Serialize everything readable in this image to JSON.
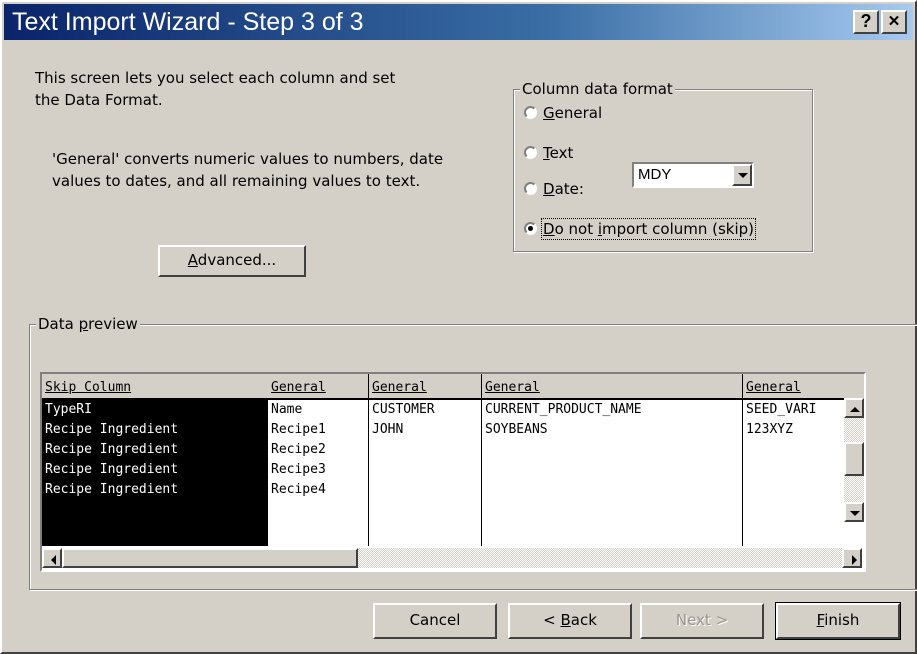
{
  "window": {
    "title": "Text Import Wizard - Step 3 of 3",
    "help_glyph": "?",
    "close_glyph": "✕"
  },
  "intro": {
    "line1": "This screen lets you select each column and set",
    "line2": "the Data Format.",
    "info1": "'General' converts numeric values to numbers, date",
    "info2": "values to dates, and all remaining values to text."
  },
  "advanced_button": {
    "pre": "",
    "accel": "A",
    "post": "dvanced..."
  },
  "column_format": {
    "legend": "Column data format",
    "options": [
      {
        "pre": "",
        "accel": "G",
        "post": "eneral",
        "checked": false
      },
      {
        "pre": "",
        "accel": "T",
        "post": "ext",
        "checked": false
      },
      {
        "pre": "",
        "accel": "D",
        "post": "ate:",
        "checked": false
      },
      {
        "pre": "",
        "accel": "D",
        "post": "o not ",
        "accel2": "i",
        "post2": "mport column (skip)",
        "checked": true
      }
    ],
    "date_format": "MDY"
  },
  "preview": {
    "legend_pre": "Data ",
    "legend_accel": "p",
    "legend_post": "review",
    "columns": [
      {
        "header": "Skip Column",
        "cells": [
          "TypeRI",
          "Recipe Ingredient",
          "Recipe Ingredient",
          "Recipe Ingredient",
          "Recipe Ingredient"
        ]
      },
      {
        "header": "General",
        "cells": [
          "Name",
          "Recipe1",
          "Recipe2",
          "Recipe3",
          "Recipe4"
        ]
      },
      {
        "header": "General",
        "cells": [
          "CUSTOMER",
          "JOHN",
          "",
          "",
          ""
        ]
      },
      {
        "header": "General",
        "cells": [
          "CURRENT_PRODUCT_NAME",
          "SOYBEANS",
          "",
          "",
          ""
        ]
      },
      {
        "header": "General",
        "cells": [
          "SEED_VARI",
          "123XYZ",
          "",
          "",
          ""
        ]
      }
    ]
  },
  "buttons": {
    "cancel": "Cancel",
    "back": {
      "pre": "< ",
      "accel": "B",
      "post": "ack"
    },
    "next": "Next >",
    "finish": {
      "pre": "",
      "accel": "F",
      "post": "inish"
    }
  },
  "colors": {
    "title_start": "#0a246a",
    "title_end": "#a6caf0",
    "face": "#d4d0c8",
    "selected_column": "#000000"
  }
}
